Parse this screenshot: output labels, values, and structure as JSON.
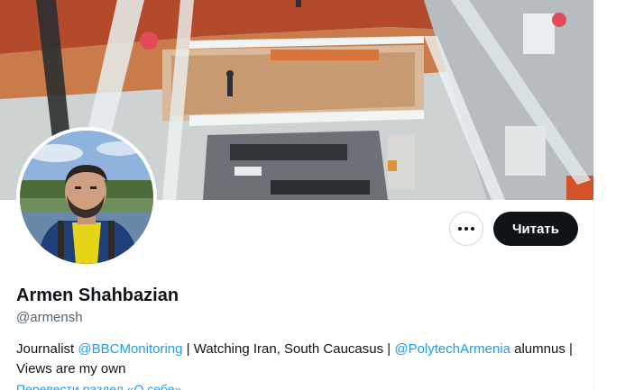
{
  "profile": {
    "display_name": "Armen Shahbazian",
    "handle": "@armensh",
    "bio": {
      "text_1": "Journalist ",
      "mention_1": "@BBCMonitoring",
      "text_2": " | Watching Iran, South Caucasus | ",
      "mention_2": "@PolytechArmenia",
      "text_3": " alumnus | Views are my own"
    },
    "translate_link": "Перевести раздел «О себе»"
  },
  "actions": {
    "more_icon": "more-horizontal-icon",
    "follow_label": "Читать"
  },
  "colors": {
    "accent": "#1d9bf0",
    "follow_bg": "#0f1419",
    "text_primary": "#0f1419",
    "text_secondary": "#536471"
  }
}
